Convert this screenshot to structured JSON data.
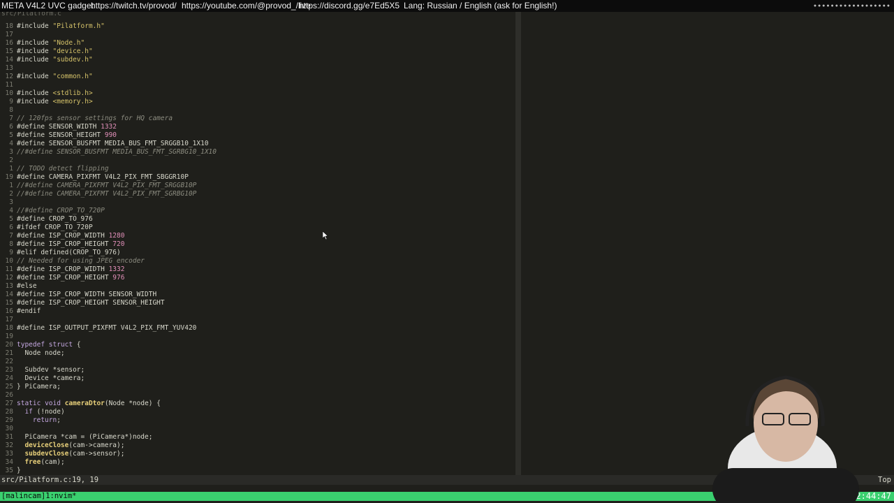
{
  "topbar": {
    "title": "META V4L2 UVC gadget",
    "twitch": "https://twitch.tv/provod/",
    "youtube": "https://youtube.com/@provod_/live",
    "discord": "https://discord.gg/e7Ed5X5",
    "lang": "Lang: Russian / English (ask for English!)"
  },
  "editor": {
    "lines": [
      {
        "n": "",
        "c": "src/Pilatform.c"
      },
      {
        "n": "18",
        "c": "#include \"Pilatform.h\""
      },
      {
        "n": "17",
        "c": ""
      },
      {
        "n": "16",
        "c": "#include \"Node.h\""
      },
      {
        "n": "15",
        "c": "#include \"device.h\""
      },
      {
        "n": "14",
        "c": "#include \"subdev.h\""
      },
      {
        "n": "13",
        "c": ""
      },
      {
        "n": "12",
        "c": "#include \"common.h\""
      },
      {
        "n": "11",
        "c": ""
      },
      {
        "n": "10",
        "c": "#include <stdlib.h>"
      },
      {
        "n": "9",
        "c": "#include <memory.h>"
      },
      {
        "n": "8",
        "c": ""
      },
      {
        "n": "7",
        "c": "// 120fps sensor settings for HQ camera"
      },
      {
        "n": "6",
        "c": "#define SENSOR_WIDTH 1332"
      },
      {
        "n": "5",
        "c": "#define SENSOR_HEIGHT 990"
      },
      {
        "n": "4",
        "c": "#define SENSOR_BUSFMT MEDIA_BUS_FMT_SRGGB10_1X10"
      },
      {
        "n": "3",
        "c": "//#define SENSOR_BUSFMT MEDIA_BUS_FMT_SGRBG10_1X10"
      },
      {
        "n": "2",
        "c": ""
      },
      {
        "n": "1",
        "c": "// TODO detect flipping"
      },
      {
        "n": "19",
        "c": "#define CAMERA_PIXFMT V4L2_PIX_FMT_SBGGR10P"
      },
      {
        "n": "1",
        "c": "//#define CAMERA_PIXFMT V4L2_PIX_FMT_SRGGB10P"
      },
      {
        "n": "2",
        "c": "//#define CAMERA_PIXFMT V4L2_PIX_FMT_SGRBG10P"
      },
      {
        "n": "3",
        "c": ""
      },
      {
        "n": "4",
        "c": "//#define CROP_TO_720P"
      },
      {
        "n": "5",
        "c": "#define CROP_TO_976"
      },
      {
        "n": "6",
        "c": "#ifdef CROP_TO_720P"
      },
      {
        "n": "7",
        "c": "#define ISP_CROP_WIDTH 1280"
      },
      {
        "n": "8",
        "c": "#define ISP_CROP_HEIGHT 720"
      },
      {
        "n": "9",
        "c": "#elif defined(CROP_TO_976)"
      },
      {
        "n": "10",
        "c": "// Needed for using JPEG encoder"
      },
      {
        "n": "11",
        "c": "#define ISP_CROP_WIDTH 1332"
      },
      {
        "n": "12",
        "c": "#define ISP_CROP_HEIGHT 976"
      },
      {
        "n": "13",
        "c": "#else"
      },
      {
        "n": "14",
        "c": "#define ISP_CROP_WIDTH SENSOR_WIDTH"
      },
      {
        "n": "15",
        "c": "#define ISP_CROP_HEIGHT SENSOR_HEIGHT"
      },
      {
        "n": "16",
        "c": "#endif"
      },
      {
        "n": "17",
        "c": ""
      },
      {
        "n": "18",
        "c": "#define ISP_OUTPUT_PIXFMT V4L2_PIX_FMT_YUV420"
      },
      {
        "n": "19",
        "c": ""
      },
      {
        "n": "20",
        "c": "typedef struct {"
      },
      {
        "n": "21",
        "c": "  Node node;"
      },
      {
        "n": "22",
        "c": ""
      },
      {
        "n": "23",
        "c": "  Subdev *sensor;"
      },
      {
        "n": "24",
        "c": "  Device *camera;"
      },
      {
        "n": "25",
        "c": "} PiCamera;"
      },
      {
        "n": "26",
        "c": ""
      },
      {
        "n": "27",
        "c": "static void cameraDtor(Node *node) {"
      },
      {
        "n": "28",
        "c": "  if (!node)"
      },
      {
        "n": "29",
        "c": "    return;"
      },
      {
        "n": "30",
        "c": ""
      },
      {
        "n": "31",
        "c": "  PiCamera *cam = (PiCamera*)node;"
      },
      {
        "n": "32",
        "c": "  deviceClose(cam->camera);"
      },
      {
        "n": "33",
        "c": "  subdevClose(cam->sensor);"
      },
      {
        "n": "34",
        "c": "  free(cam);"
      },
      {
        "n": "35",
        "c": "}"
      },
      {
        "n": "36",
        "c": ""
      }
    ]
  },
  "statusline": {
    "file": "src/Pilatform.c:19, 19",
    "position": "Top"
  },
  "tmux": {
    "session": "[malincam]1:nvim*",
    "clock": "2:44:47"
  }
}
